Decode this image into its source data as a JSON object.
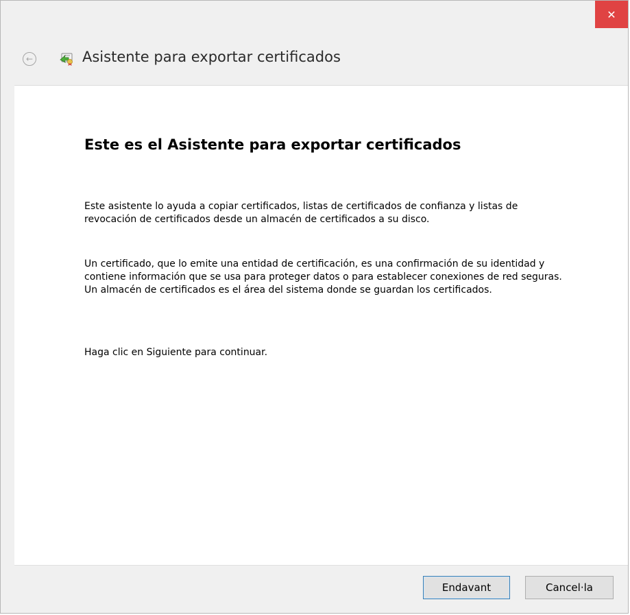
{
  "window": {
    "close_glyph": "✕",
    "back_glyph": "←",
    "title": "Asistente para exportar certificados",
    "icon": "certificate-icon"
  },
  "main": {
    "heading": "Este es el Asistente para exportar certificados",
    "paragraphs": [
      "Este asistente lo ayuda a copiar certificados, listas de certificados de confianza y listas de revocación de certificados desde un almacén de certificados a su disco.",
      "Un certificado, que lo emite una entidad de certificación, es una confirmación de su identidad y contiene información que se usa para proteger datos o para establecer conexiones de red seguras. Un almacén de certificados es el área del sistema donde se guardan los certificados.",
      "Haga clic en Siguiente para continuar."
    ]
  },
  "footer": {
    "next_label": "Endavant",
    "cancel_label": "Cancel·la"
  },
  "colors": {
    "close_button": "#e04343",
    "window_chrome": "#f0f0f0",
    "content_background": "#ffffff",
    "default_button_border": "#3c7fb1"
  }
}
